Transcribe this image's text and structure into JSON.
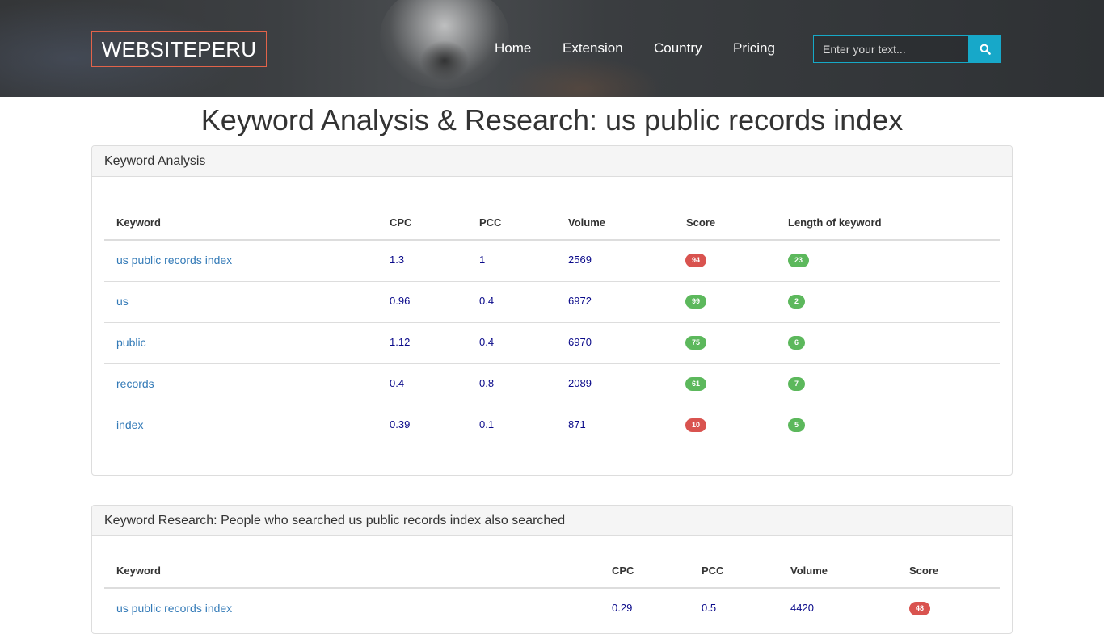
{
  "header": {
    "logo": "WEBSITEPERU",
    "nav": [
      "Home",
      "Extension",
      "Country",
      "Pricing"
    ],
    "search": {
      "placeholder": "Enter your text..."
    }
  },
  "page_title": "Keyword Analysis & Research: us public records index",
  "analysis": {
    "heading": "Keyword Analysis",
    "columns": [
      "Keyword",
      "CPC",
      "PCC",
      "Volume",
      "Score",
      "Length of keyword"
    ],
    "rows": [
      {
        "keyword": "us public records index",
        "cpc": "1.3",
        "pcc": "1",
        "volume": "2569",
        "score": "94",
        "length": "23",
        "score_color": "#d9534f",
        "length_color": "#5cb85c"
      },
      {
        "keyword": "us",
        "cpc": "0.96",
        "pcc": "0.4",
        "volume": "6972",
        "score": "99",
        "length": "2",
        "score_color": "#5cb85c",
        "length_color": "#5cb85c"
      },
      {
        "keyword": "public",
        "cpc": "1.12",
        "pcc": "0.4",
        "volume": "6970",
        "score": "75",
        "length": "6",
        "score_color": "#5cb85c",
        "length_color": "#5cb85c"
      },
      {
        "keyword": "records",
        "cpc": "0.4",
        "pcc": "0.8",
        "volume": "2089",
        "score": "61",
        "length": "7",
        "score_color": "#5cb85c",
        "length_color": "#5cb85c"
      },
      {
        "keyword": "index",
        "cpc": "0.39",
        "pcc": "0.1",
        "volume": "871",
        "score": "10",
        "length": "5",
        "score_color": "#d9534f",
        "length_color": "#5cb85c"
      }
    ]
  },
  "research": {
    "heading": "Keyword Research: People who searched us public records index also searched",
    "columns": [
      "Keyword",
      "CPC",
      "PCC",
      "Volume",
      "Score"
    ],
    "rows": [
      {
        "keyword": "us public records index",
        "cpc": "0.29",
        "pcc": "0.5",
        "volume": "4420",
        "score": "48",
        "score_color": "#d9534f"
      }
    ]
  },
  "colors": {
    "accent": "#17a8c9",
    "logo_border": "#e2634a",
    "link": "#337ab7",
    "value": "#0a0a8a",
    "badge_red": "#d9534f",
    "badge_green": "#5cb85c"
  }
}
